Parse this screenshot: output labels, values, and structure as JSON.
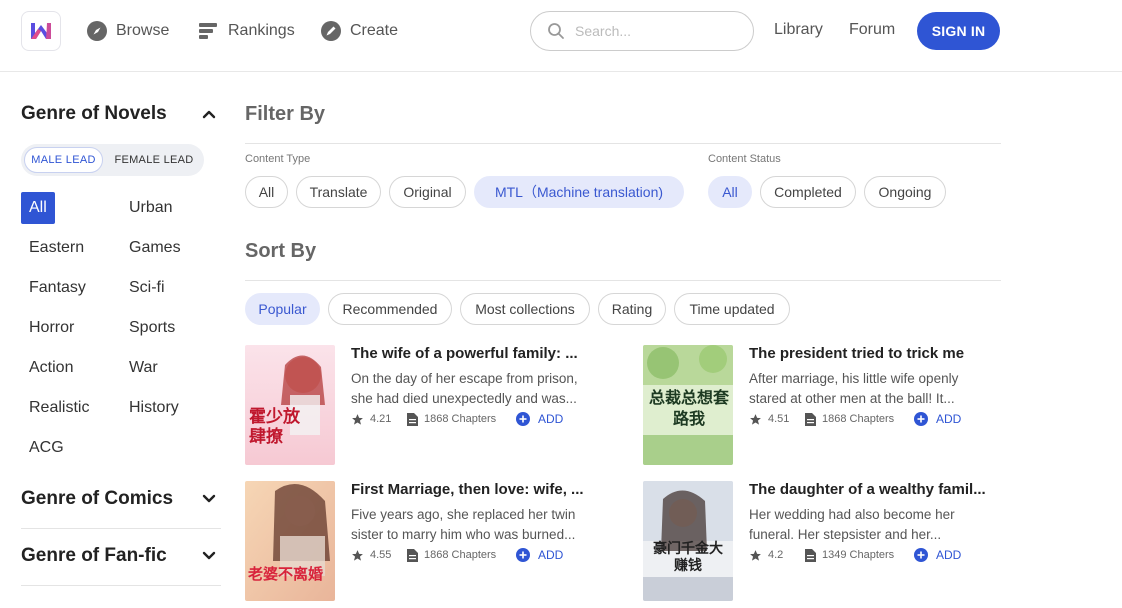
{
  "header": {
    "nav": [
      {
        "label": "Browse",
        "icon": "compass-icon"
      },
      {
        "label": "Rankings",
        "icon": "bars-icon"
      },
      {
        "label": "Create",
        "icon": "pen-icon"
      }
    ],
    "search_placeholder": "Search...",
    "library": "Library",
    "forum": "Forum",
    "signin": "SIGN IN",
    "accent": "#2f55d4"
  },
  "sidebar": {
    "novels_title": "Genre of Novels",
    "lead": {
      "male": "MALE LEAD",
      "female": "FEMALE LEAD",
      "selected": "MALE LEAD"
    },
    "genres": [
      "All",
      "Urban",
      "Eastern",
      "Games",
      "Fantasy",
      "Sci-fi",
      "Horror",
      "Sports",
      "Action",
      "War",
      "Realistic",
      "History",
      "ACG"
    ],
    "selected_genre": "All",
    "comics_title": "Genre of Comics",
    "fanfic_title": "Genre of Fan-fic"
  },
  "filter": {
    "title": "Filter By",
    "content_type_label": "Content Type",
    "content_types": [
      "All",
      "Translate",
      "Original",
      "MTL（Machine translation)"
    ],
    "content_type_selected": "MTL（Machine translation)",
    "content_status_label": "Content Status",
    "content_statuses": [
      "All",
      "Completed",
      "Ongoing"
    ],
    "content_status_selected": "All"
  },
  "sort": {
    "title": "Sort By",
    "options": [
      "Popular",
      "Recommended",
      "Most collections",
      "Rating",
      "Time updated"
    ],
    "selected": "Popular"
  },
  "books": [
    {
      "title": "The wife of a powerful family: ...",
      "desc": "On the day of her escape from prison, she had died unexpectedly and was...",
      "rating": "4.21",
      "chapters": "1868 Chapters",
      "add": "ADD",
      "cover_text": "霍少放肆撩"
    },
    {
      "title": "The president tried to trick me",
      "desc": "After marriage, his little wife openly stared at other men at the ball! It...",
      "rating": "4.51",
      "chapters": "1868 Chapters",
      "add": "ADD",
      "cover_text": "总裁总想套路我"
    },
    {
      "title": "First Marriage, then love: wife, ...",
      "desc": "Five years ago, she replaced her twin sister to marry him who was burned...",
      "rating": "4.55",
      "chapters": "1868 Chapters",
      "add": "ADD",
      "cover_text": "老婆不离婚"
    },
    {
      "title": "The daughter of a wealthy famil...",
      "desc": "Her wedding had also become her funeral. Her stepsister and her...",
      "rating": "4.2",
      "chapters": "1349 Chapters",
      "add": "ADD",
      "cover_text": "豪门千金大赚钱"
    }
  ]
}
